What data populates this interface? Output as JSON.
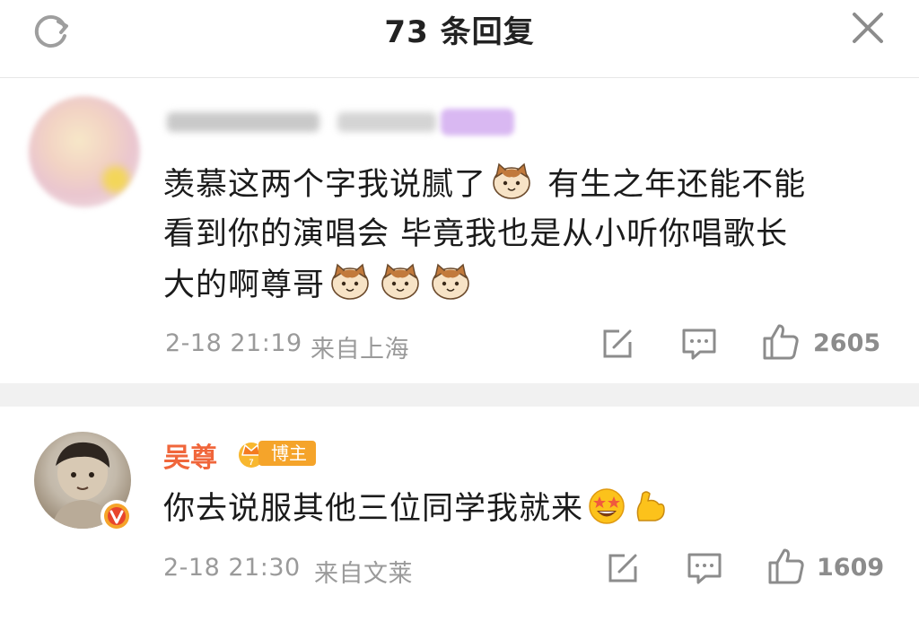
{
  "header": {
    "title": "73 条回复"
  },
  "comments": [
    {
      "text_lines": [
        "羡慕这两个字我说腻了",
        "有生之年还能不能",
        "看到你的演唱会 毕竟我也是从小听你唱歌长",
        "大的啊尊哥"
      ],
      "date": "2-18 21:19",
      "location": "来自上海",
      "likes": "2605"
    },
    {
      "author": "吴尊",
      "badge": "博主",
      "text": "你去说服其他三位同学我就来",
      "date": "2-18 21:30",
      "location": "来自文莱",
      "likes": "1609"
    }
  ],
  "colors": {
    "author_name": "#f0663b",
    "badge_bg": "#f5a42a",
    "meta_text": "#9a9a9a",
    "separator": "#f1f1f1"
  }
}
